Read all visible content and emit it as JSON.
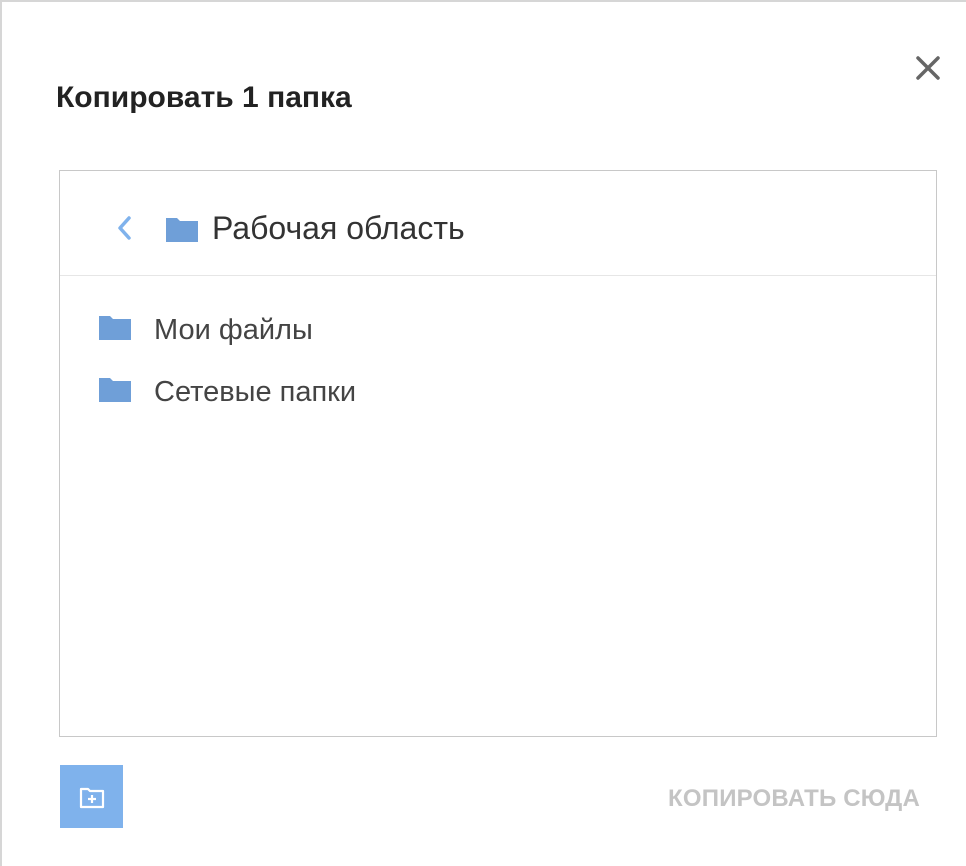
{
  "dialog": {
    "title": "Копировать 1 папка",
    "close_icon": "close-icon"
  },
  "browser": {
    "back_icon": "chevron-left-icon",
    "current_folder_icon": "folder-icon",
    "current_folder": "Рабочая область",
    "items": [
      {
        "label": "Мои файлы",
        "icon": "folder-icon"
      },
      {
        "label": "Сетевые папки",
        "icon": "folder-icon"
      }
    ]
  },
  "footer": {
    "new_folder_icon": "add-folder-icon",
    "copy_here_label": "КОПИРОВАТЬ СЮДА",
    "copy_here_enabled": false
  },
  "colors": {
    "accent": "#7fb2ec",
    "folder": "#6f9fd8",
    "disabled_text": "#c4c4c4"
  }
}
